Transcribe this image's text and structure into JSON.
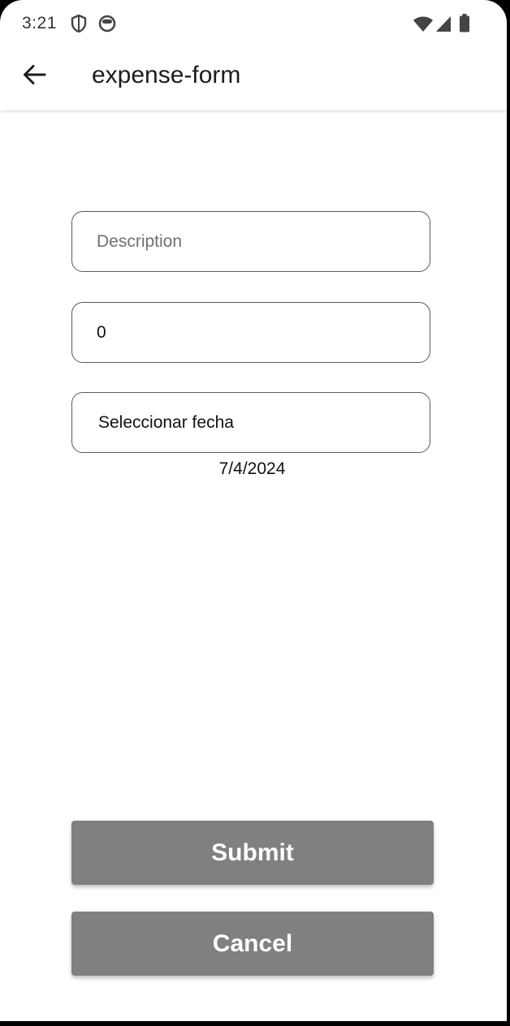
{
  "status_bar": {
    "time": "3:21",
    "left_icons": [
      "shield-icon",
      "face-icon"
    ],
    "right_icons": [
      "wifi-icon",
      "signal-icon",
      "battery-icon"
    ]
  },
  "app_bar": {
    "back_icon": "arrow-left-icon",
    "title": "expense-form"
  },
  "form": {
    "description": {
      "placeholder": "Description",
      "value": ""
    },
    "amount": {
      "value": "0"
    },
    "date_button_label": "Seleccionar fecha",
    "selected_date": "7/4/2024"
  },
  "actions": {
    "submit_label": "Submit",
    "cancel_label": "Cancel"
  },
  "colors": {
    "button_bg": "#808080",
    "button_text": "#ffffff",
    "field_border": "#5a5a5a",
    "background": "#ffffff"
  }
}
